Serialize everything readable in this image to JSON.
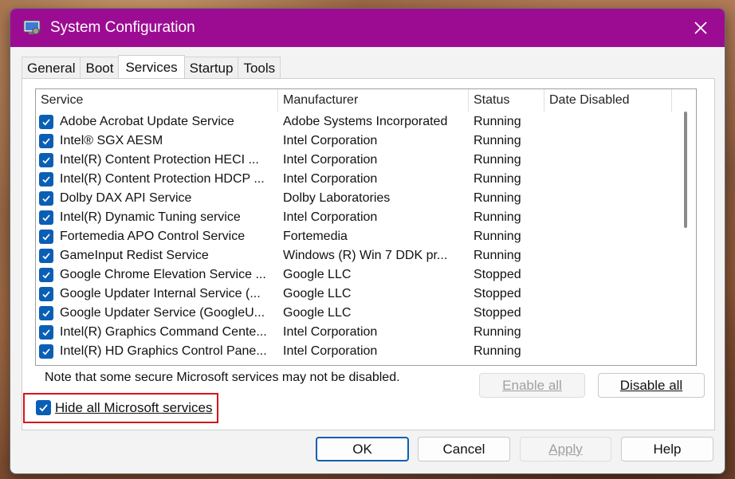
{
  "window": {
    "title": "System Configuration",
    "colors": {
      "titlebar": "#9c0c93",
      "accent": "#0a5fb5",
      "highlight_box": "#d7141a"
    }
  },
  "tabs": [
    {
      "label": "General"
    },
    {
      "label": "Boot"
    },
    {
      "label": "Services",
      "active": true
    },
    {
      "label": "Startup"
    },
    {
      "label": "Tools"
    }
  ],
  "services_table": {
    "columns": [
      "Service",
      "Manufacturer",
      "Status",
      "Date Disabled"
    ],
    "rows": [
      {
        "checked": true,
        "service": "Adobe Acrobat Update Service",
        "manufacturer": "Adobe Systems Incorporated",
        "status": "Running",
        "date_disabled": ""
      },
      {
        "checked": true,
        "service": "Intel® SGX AESM",
        "manufacturer": "Intel Corporation",
        "status": "Running",
        "date_disabled": ""
      },
      {
        "checked": true,
        "service": "Intel(R) Content Protection HECI ...",
        "manufacturer": "Intel Corporation",
        "status": "Running",
        "date_disabled": ""
      },
      {
        "checked": true,
        "service": "Intel(R) Content Protection HDCP ...",
        "manufacturer": "Intel Corporation",
        "status": "Running",
        "date_disabled": ""
      },
      {
        "checked": true,
        "service": "Dolby DAX API Service",
        "manufacturer": "Dolby Laboratories",
        "status": "Running",
        "date_disabled": ""
      },
      {
        "checked": true,
        "service": "Intel(R) Dynamic Tuning service",
        "manufacturer": "Intel Corporation",
        "status": "Running",
        "date_disabled": ""
      },
      {
        "checked": true,
        "service": "Fortemedia APO Control Service",
        "manufacturer": "Fortemedia",
        "status": "Running",
        "date_disabled": ""
      },
      {
        "checked": true,
        "service": "GameInput Redist Service",
        "manufacturer": "Windows (R) Win 7 DDK pr...",
        "status": "Running",
        "date_disabled": ""
      },
      {
        "checked": true,
        "service": "Google Chrome Elevation Service ...",
        "manufacturer": "Google LLC",
        "status": "Stopped",
        "date_disabled": ""
      },
      {
        "checked": true,
        "service": "Google Updater Internal Service (...",
        "manufacturer": "Google LLC",
        "status": "Stopped",
        "date_disabled": ""
      },
      {
        "checked": true,
        "service": "Google Updater Service (GoogleU...",
        "manufacturer": "Google LLC",
        "status": "Stopped",
        "date_disabled": ""
      },
      {
        "checked": true,
        "service": "Intel(R) Graphics Command Cente...",
        "manufacturer": "Intel Corporation",
        "status": "Running",
        "date_disabled": ""
      },
      {
        "checked": true,
        "service": "Intel(R) HD Graphics Control Pane...",
        "manufacturer": "Intel Corporation",
        "status": "Running",
        "date_disabled": ""
      }
    ]
  },
  "note": "Note that some secure Microsoft services may not be disabled.",
  "buttons": {
    "enable_all": {
      "label": "Enable all",
      "enabled": false
    },
    "disable_all": {
      "label": "Disable all",
      "enabled": true
    },
    "ok": "OK",
    "cancel": "Cancel",
    "apply": {
      "label": "Apply",
      "enabled": false
    },
    "help": "Help"
  },
  "hide_microsoft": {
    "label": "Hide all Microsoft services",
    "checked": true
  },
  "icons": [
    "system-config-icon",
    "close-icon",
    "checkmark-icon"
  ]
}
